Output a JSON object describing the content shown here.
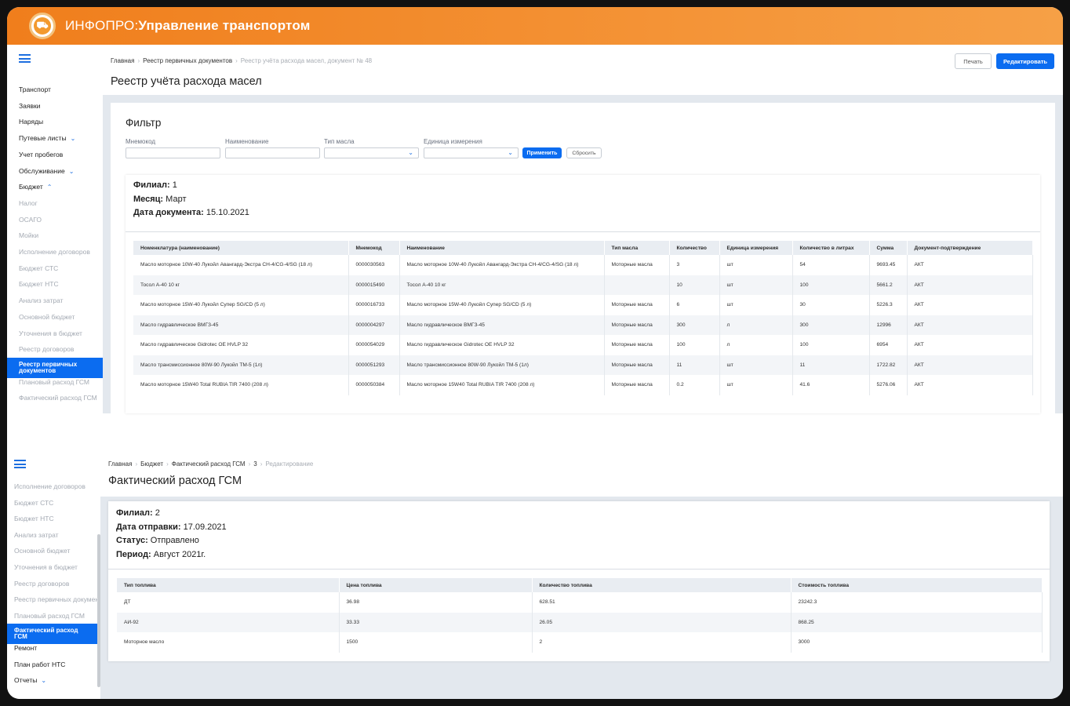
{
  "app": {
    "brand": "ИНФОПРО:",
    "name": "Управление транспортом",
    "logo_icon": "truck-logo-icon"
  },
  "panel1": {
    "sidebar": [
      {
        "label": "Транспорт",
        "state": "normal"
      },
      {
        "label": "Заявки",
        "state": "normal"
      },
      {
        "label": "Наряды",
        "state": "normal"
      },
      {
        "label": "Путевые листы",
        "state": "normal",
        "chevron": "⌄"
      },
      {
        "label": "Учет пробегов",
        "state": "normal"
      },
      {
        "label": "Обслуживание",
        "state": "normal",
        "chevron": "⌄"
      },
      {
        "label": "Бюджет",
        "state": "normal",
        "chevron": "⌃"
      },
      {
        "label": "Налог",
        "state": "muted"
      },
      {
        "label": "ОСАГО",
        "state": "muted"
      },
      {
        "label": "Мойки",
        "state": "muted"
      },
      {
        "label": "Исполнение договоров",
        "state": "muted"
      },
      {
        "label": "Бюджет СТС",
        "state": "muted"
      },
      {
        "label": "Бюджет НТС",
        "state": "muted"
      },
      {
        "label": "Анализ затрат",
        "state": "muted"
      },
      {
        "label": "Основной бюджет",
        "state": "muted"
      },
      {
        "label": "Уточнения в бюджет",
        "state": "muted"
      },
      {
        "label": "Реестр договоров",
        "state": "muted"
      },
      {
        "label": "Реестр первичных документов",
        "state": "active"
      },
      {
        "label": "Плановый расход ГСМ",
        "state": "muted"
      },
      {
        "label": "Фактический расход ГСМ",
        "state": "muted"
      }
    ],
    "breadcrumb": [
      "Главная",
      "Реестр первичных документов"
    ],
    "breadcrumb_current": "Реестр учёта расхода масел, документ № 48",
    "title": "Реестр учёта расхода масел",
    "print_label": "Печать",
    "edit_label": "Редактировать",
    "filter": {
      "title": "Фильтр",
      "fields": [
        {
          "label": "Мнемокод",
          "type": "text",
          "value": ""
        },
        {
          "label": "Наименование",
          "type": "text",
          "value": ""
        },
        {
          "label": "Тип масла",
          "type": "select",
          "value": ""
        },
        {
          "label": "Единица измерения",
          "type": "select",
          "value": ""
        }
      ],
      "apply_label": "Применить",
      "reset_label": "Сбросить"
    },
    "info": [
      {
        "label": "Филиал:",
        "value": "1"
      },
      {
        "label": "Месяц:",
        "value": "Март"
      },
      {
        "label": "Дата документа:",
        "value": "15.10.2021"
      }
    ],
    "columns": [
      "Номенклатура (наименование)",
      "Мнемокод",
      "Наименование",
      "Тип масла",
      "Количество",
      "Единица измерения",
      "Количество в литрах",
      "Сумма",
      "Документ-подтверждение"
    ],
    "rows": [
      [
        "Масло моторное 10W-40 Лукойл Авангард-Экстра CH-4/CG-4/SG (18 л)",
        "0000030563",
        "Масло моторное 10W-40 Лукойл Авангард-Экстра CH-4/CG-4/SG (18 л)",
        "Моторные масла",
        "3",
        "шт",
        "54",
        "9693.45",
        "АКТ"
      ],
      [
        "Тосол А-40 10 кг",
        "0000015490",
        "Тосол А-40 10 кг",
        "",
        "10",
        "шт",
        "100",
        "5661.2",
        "АКТ"
      ],
      [
        "Масло моторное 15W-40 Лукойл Супер SG/CD (5 л)",
        "0000016733",
        "Масло моторное 15W-40 Лукойл Супер SG/CD (5 л)",
        "Моторные масла",
        "6",
        "шт",
        "30",
        "5226.3",
        "АКТ"
      ],
      [
        "Масло гидравлическое ВМГЗ-45",
        "0000004297",
        "Масло гидравлическое ВМГЗ-45",
        "Моторные масла",
        "300",
        "л",
        "300",
        "12996",
        "АКТ"
      ],
      [
        "Масло гидравлическое Gidrotec OE HVLP 32",
        "0000054029",
        "Масло гидравлическое Gidrotec OE HVLP 32",
        "Моторные масла",
        "100",
        "л",
        "100",
        "6954",
        "АКТ"
      ],
      [
        "Масло трансмиссионное 80W-90 Лукойл ТМ-5 (1л)",
        "0000051293",
        "Масло трансмиссионное 80W-90 Лукойл ТМ-5 (1л)",
        "Моторные масла",
        "11",
        "шт",
        "11",
        "1722.82",
        "АКТ"
      ],
      [
        "Масло моторное 15W40 Total RUBIA TIR 7400 (208 л)",
        "0000050384",
        "Масло моторное 15W40 Total RUBIA TIR 7400 (208 л)",
        "Моторные масла",
        "0.2",
        "шт",
        "41.6",
        "5276.06",
        "АКТ"
      ]
    ]
  },
  "panel2": {
    "sidebar": [
      {
        "label": "Исполнение договоров",
        "state": "muted"
      },
      {
        "label": "Бюджет СТС",
        "state": "muted"
      },
      {
        "label": "Бюджет НТС",
        "state": "muted"
      },
      {
        "label": "Анализ затрат",
        "state": "muted"
      },
      {
        "label": "Основной бюджет",
        "state": "muted"
      },
      {
        "label": "Уточнения в бюджет",
        "state": "muted"
      },
      {
        "label": "Реестр договоров",
        "state": "muted"
      },
      {
        "label": "Реестр первичных документов",
        "state": "muted"
      },
      {
        "label": "Плановый расход ГСМ",
        "state": "muted"
      },
      {
        "label": "Фактический расход ГСМ",
        "state": "active"
      },
      {
        "label": "Ремонт",
        "state": "normal"
      },
      {
        "label": "План работ НТС",
        "state": "normal"
      },
      {
        "label": "Отчеты",
        "state": "normal",
        "chevron": "⌄"
      }
    ],
    "breadcrumb": [
      "Главная",
      "Бюджет",
      "Фактический расход ГСМ",
      "3"
    ],
    "breadcrumb_current": "Редактирование",
    "title": "Фактический расход ГСМ",
    "info": [
      {
        "label": "Филиал:",
        "value": "2"
      },
      {
        "label": "Дата отправки:",
        "value": "17.09.2021"
      },
      {
        "label": "Статус:",
        "value": "Отправлено"
      },
      {
        "label": "Период:",
        "value": "Август 2021г."
      }
    ],
    "columns": [
      "Тип топлива",
      "Цена топлива",
      "Количество топлива",
      "Стоимость топлива"
    ],
    "rows": [
      [
        "ДТ",
        "36.98",
        "628.51",
        "23242.3"
      ],
      [
        "АИ-92",
        "33.33",
        "26.05",
        "868.25"
      ],
      [
        "Моторное масло",
        "1500",
        "2",
        "3000"
      ]
    ]
  },
  "colors": {
    "header_start": "#f07e1c",
    "header_end": "#f6a046",
    "accent": "#0b6cf0",
    "content_bg": "#e3e8ee"
  }
}
